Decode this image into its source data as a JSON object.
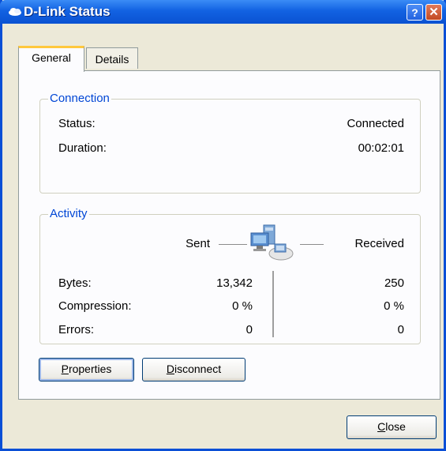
{
  "window": {
    "title": "D-Link Status",
    "help_glyph": "?",
    "close_glyph": "✕"
  },
  "tabs": [
    {
      "label": "General"
    },
    {
      "label": "Details"
    }
  ],
  "connection": {
    "group_label": "Connection",
    "status_label": "Status:",
    "status_value": "Connected",
    "duration_label": "Duration:",
    "duration_value": "00:02:01"
  },
  "activity": {
    "group_label": "Activity",
    "sent_label": "Sent",
    "received_label": "Received",
    "rows": [
      {
        "label": "Bytes:",
        "sent": "13,342",
        "received": "250"
      },
      {
        "label": "Compression:",
        "sent": "0 %",
        "received": "0 %"
      },
      {
        "label": "Errors:",
        "sent": "0",
        "received": "0"
      }
    ]
  },
  "buttons": {
    "properties": {
      "mnemonic": "P",
      "rest": "roperties"
    },
    "disconnect": {
      "mnemonic": "D",
      "rest": "isconnect"
    },
    "close": {
      "mnemonic": "C",
      "rest": "lose"
    }
  }
}
